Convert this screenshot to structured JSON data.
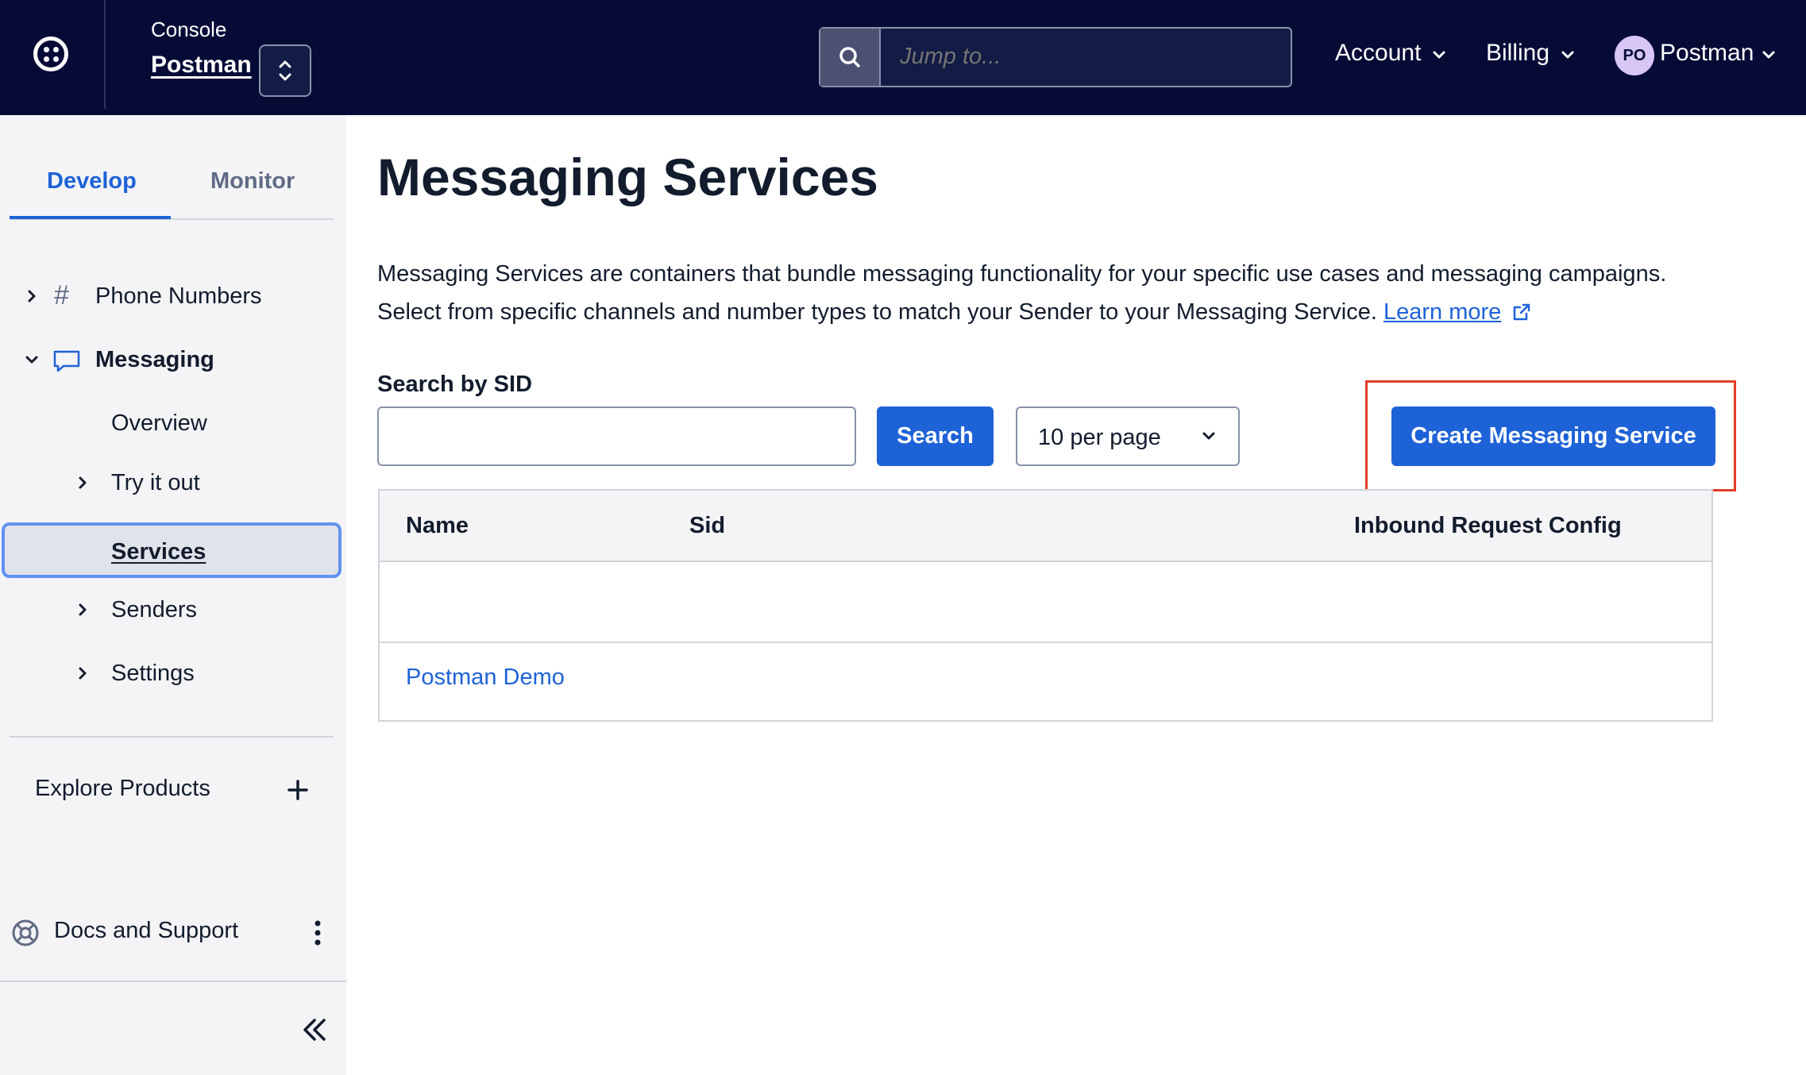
{
  "topbar": {
    "console_label": "Console",
    "account_name": "Postman",
    "search_placeholder": "Jump to...",
    "account_menu": "Account",
    "billing_menu": "Billing",
    "avatar_initials": "PO",
    "user_name": "Postman"
  },
  "sidebar": {
    "tabs": [
      {
        "label": "Develop",
        "active": true
      },
      {
        "label": "Monitor",
        "active": false
      }
    ],
    "phone_numbers": "Phone Numbers",
    "messaging": "Messaging",
    "overview": "Overview",
    "try_it_out": "Try it out",
    "services": "Services",
    "senders": "Senders",
    "settings": "Settings",
    "explore_products": "Explore Products",
    "docs_support": "Docs and Support"
  },
  "main": {
    "title": "Messaging Services",
    "description_line1": "Messaging Services are containers that bundle messaging functionality for your specific use cases and messaging campaigns.",
    "description_line2": "Select from specific channels and number types to match your Sender to your Messaging Service.",
    "learn_more": "Learn more",
    "search_label": "Search by SID",
    "search_value": "",
    "search_button": "Search",
    "per_page": "10 per page",
    "create_button": "Create Messaging Service",
    "table": {
      "columns": [
        "Name",
        "Sid",
        "Inbound Request Config"
      ],
      "rows": [
        {
          "name": "Postman Demo",
          "sid": "",
          "inbound_request_config": ""
        }
      ]
    }
  },
  "colors": {
    "topbar_bg": "#060b36",
    "accent": "#1e62d8",
    "highlight": "#e23d28"
  }
}
